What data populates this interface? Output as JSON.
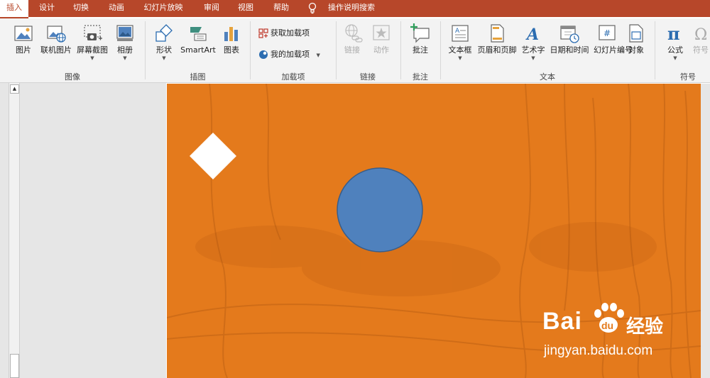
{
  "tabs": [
    {
      "label": "插入",
      "active": true
    },
    {
      "label": "设计"
    },
    {
      "label": "切换"
    },
    {
      "label": "动画"
    },
    {
      "label": "幻灯片放映"
    },
    {
      "label": "审阅"
    },
    {
      "label": "视图"
    },
    {
      "label": "帮助"
    },
    {
      "label": "操作说明搜索"
    }
  ],
  "ribbon": {
    "images": {
      "label": "图像",
      "picture": "图片",
      "online_picture": "联机图片",
      "screenshot": "屏幕截图",
      "album": "相册"
    },
    "illustrations": {
      "label": "插图",
      "shapes": "形状",
      "smartart": "SmartArt",
      "chart": "图表"
    },
    "addins": {
      "label": "加载项",
      "get_addins": "获取加载项",
      "my_addins": "我的加载项"
    },
    "links": {
      "label": "链接",
      "link": "链接",
      "action": "动作"
    },
    "comments": {
      "label": "批注",
      "comment": "批注"
    },
    "text": {
      "label": "文本",
      "textbox": "文本框",
      "header_footer": "页眉和页脚",
      "wordart": "艺术字",
      "datetime": "日期和时间",
      "slide_number": "幻灯片编号",
      "object": "对象"
    },
    "symbols": {
      "label": "符号",
      "equation": "公式",
      "symbol": "符号"
    }
  },
  "colors": {
    "accent": "#b7472a",
    "slide_bg": "#e47a1c",
    "circle_fill": "#4f81bd",
    "circle_stroke": "#385d8a",
    "diamond_fill": "#ffffff"
  },
  "watermark": {
    "brand": "Bai",
    "brand2": "du",
    "cn": "经验",
    "url": "jingyan.baidu.com"
  }
}
